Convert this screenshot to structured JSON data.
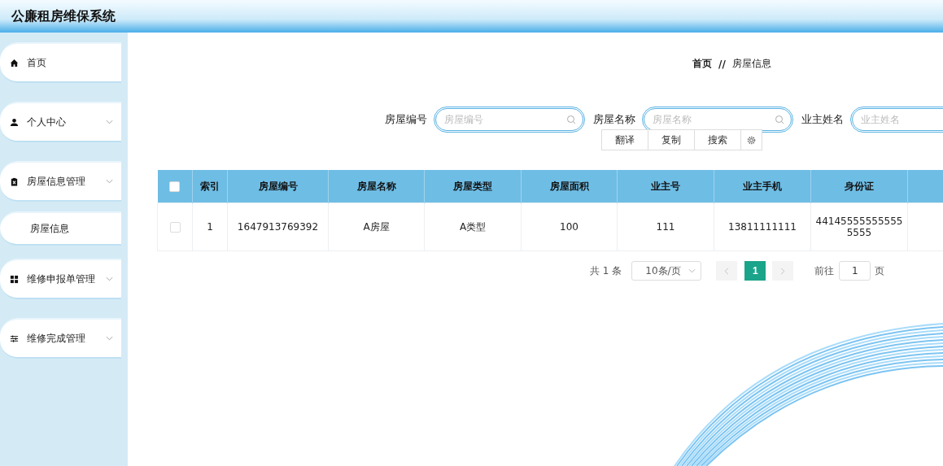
{
  "app_title": "公廉租房维保系统",
  "sidebar": {
    "items": [
      {
        "label": "首页",
        "has_submenu": false
      },
      {
        "label": "个人中心",
        "has_submenu": true
      },
      {
        "label": "房屋信息管理",
        "has_submenu": true,
        "children": [
          {
            "label": "房屋信息"
          }
        ]
      },
      {
        "label": "维修申报单管理",
        "has_submenu": true
      },
      {
        "label": "维修完成管理",
        "has_submenu": true
      }
    ]
  },
  "breadcrumb": [
    "首页",
    "房屋信息"
  ],
  "breadcrumb_separator": "//",
  "search": [
    {
      "label": "房屋编号",
      "placeholder": "房屋编号"
    },
    {
      "label": "房屋名称",
      "placeholder": "房屋名称"
    },
    {
      "label": "业主姓名",
      "placeholder": "业主姓名"
    }
  ],
  "popup_menu": [
    "翻译",
    "复制",
    "搜索"
  ],
  "table": {
    "select_all_checked": false,
    "columns": [
      "索引",
      "房屋编号",
      "房屋名称",
      "房屋类型",
      "房屋面积",
      "业主号",
      "业主手机",
      "身份证"
    ],
    "rows": [
      {
        "checked": false,
        "cells": [
          "1",
          "1647913769392",
          "A房屋",
          "A类型",
          "100",
          "111",
          "13811111111",
          "441455555555555555"
        ]
      }
    ]
  },
  "pagination": {
    "total": "共 1 条",
    "page_size": "10条/页",
    "pages": [
      {
        "label": "1",
        "selected": true
      }
    ],
    "goto_label": "前往",
    "goto_value": "1",
    "goto_suffix": "页"
  }
}
